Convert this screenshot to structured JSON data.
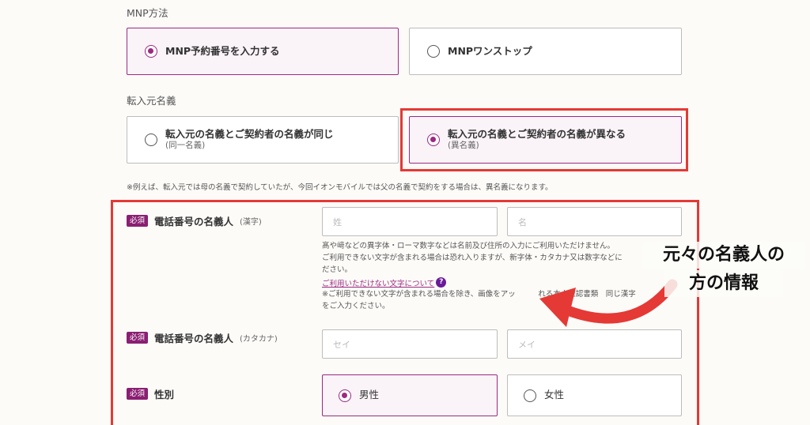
{
  "mnp": {
    "label": "MNP方法",
    "options": [
      {
        "label": "MNP予約番号を入力する",
        "selected": true
      },
      {
        "label": "MNPワンストップ",
        "selected": false
      }
    ]
  },
  "transfer_name": {
    "label": "転入元名義",
    "options": [
      {
        "label": "転入元の名義とご契約者の名義が同じ",
        "sub": "(同一名義)",
        "selected": false
      },
      {
        "label": "転入元の名義とご契約者の名義が異なる",
        "sub": "(異名義)",
        "selected": true
      }
    ],
    "note": "※例えば、転入元では母の名義で契約していたが、今回イオンモバイルでは父の名義で契約をする場合は、異名義になります。"
  },
  "fields": {
    "required_badge": "必須",
    "kanji": {
      "label": "電話番号の名義人",
      "hint": "(漢字)",
      "last_placeholder": "姓",
      "first_placeholder": "名",
      "help_lines": [
        "髙や﨑などの異字体・ローマ数字などは名前及び住所の入力にご利用いただけません。",
        "ご利用できない文字が含まれる場合は恐れ入りますが、新字体・カタカナ又は数字などに",
        "ださい。"
      ],
      "help_link": "ご利用いただけない文字について",
      "help_icon": "?",
      "help_lines2": [
        "※ご利用できない文字が含まれる場合を除き、画像をアッ　　　れる本人確認書類　同じ漢字",
        "をご入力ください。"
      ]
    },
    "kana": {
      "label": "電話番号の名義人",
      "hint": "(カタカナ)",
      "last_placeholder": "セイ",
      "first_placeholder": "メイ"
    },
    "gender": {
      "label": "性別",
      "options": [
        {
          "label": "男性",
          "selected": true
        },
        {
          "label": "女性",
          "selected": false
        }
      ]
    }
  },
  "annotation": {
    "line1": "元々の名義人の",
    "line2": "方の情報",
    "color": "#e53935"
  }
}
